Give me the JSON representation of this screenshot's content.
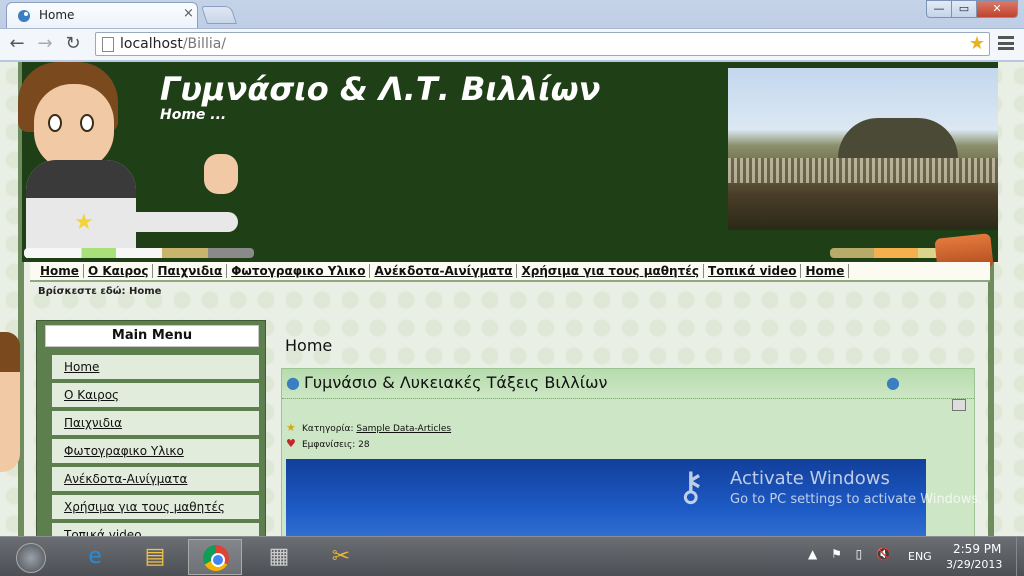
{
  "browser": {
    "tab_title": "Home",
    "tab_close": "×",
    "url_host": "localhost",
    "url_path": "/Billia/",
    "back": "←",
    "forward": "→",
    "reload": "↻",
    "star": "★",
    "min": "—",
    "max": "▭",
    "close": "✕"
  },
  "site": {
    "title": "Γυμνάσιο & Λ.Τ. Βιλλίων",
    "subtitle": "Home ...",
    "nav": [
      "Home",
      "Ο Καιρος",
      "Παιχνιδια",
      "Φωτογραφικο Υλικο",
      "Ανέκδοτα-Αινίγματα",
      "Χρήσιμα για τους μαθητές",
      "Τοπικά video",
      "Home"
    ],
    "breadcrumb_label": "Βρίσκεστε εδώ:",
    "breadcrumb_current": "Home"
  },
  "menu": {
    "title": "Main Menu",
    "items": [
      "Home",
      "Ο Καιρος",
      "Παιχνιδια",
      "Φωτογραφικο Υλικο",
      "Ανέκδοτα-Αινίγματα",
      "Χρήσιμα για τους μαθητές",
      "Τοπικά video"
    ]
  },
  "content": {
    "heading": "Home",
    "article_title": "Γυμνάσιο & Λυκειακές Τάξεις Βιλλίων",
    "category_label": "Κατηγορία:",
    "category_value": "Sample Data-Articles",
    "hits_label": "Εμφανίσεις:",
    "hits_value": "28"
  },
  "watermark": {
    "title": "Activate Windows",
    "subtitle": "Go to PC settings to activate Windows."
  },
  "taskbar": {
    "language": "ENG",
    "time": "2:59 PM",
    "date": "3/29/2013",
    "tray_up": "▲",
    "tray_flag": "⚑",
    "tray_battery": "▯",
    "tray_volume": "🔇"
  },
  "colors": {
    "header_green": "#1f3f17",
    "menu_green": "#5d7f4e",
    "article_bg": "#cde6c5"
  }
}
